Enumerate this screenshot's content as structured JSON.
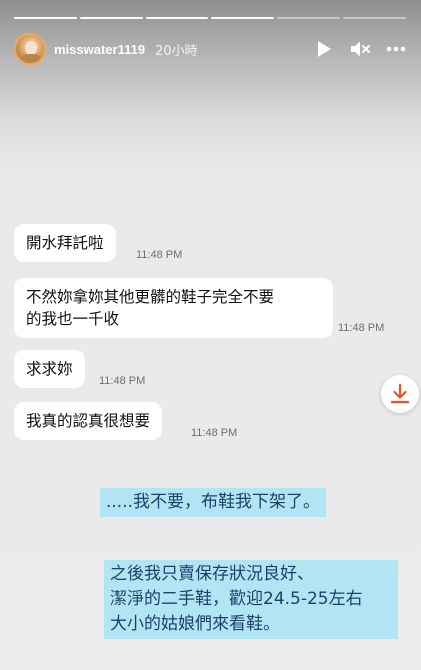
{
  "story": {
    "username": "misswater1119",
    "time_ago": "20小時",
    "progress_segments": 6,
    "progress_completed": 4
  },
  "icons": {
    "play": "play-icon",
    "mute": "muted-speaker-icon",
    "more": "more-horizontal-icon",
    "download": "download-arrow-icon"
  },
  "messages": [
    {
      "text": "開水拜託啦",
      "time": "11:48 PM"
    },
    {
      "text_line1": "不然妳拿妳其他更髒的鞋子完全不要",
      "text_line2": "的我也一千收",
      "time": "11:48 PM"
    },
    {
      "text": "求求妳",
      "time": "11:48 PM"
    },
    {
      "text": "我真的認真很想要",
      "time": "11:48 PM"
    }
  ],
  "captions": {
    "first": ".....我不要，布鞋我下架了。",
    "second_line1": "之後我只賣保存狀況良好、",
    "second_line2": "潔淨的二手鞋，歡迎24.5-25左右",
    "second_line3": "大小的姑娘們來看鞋。"
  },
  "colors": {
    "accent_download": "#e0552a",
    "caption_bg": "#a8e4f6",
    "caption_text": "#1f3f6b"
  }
}
